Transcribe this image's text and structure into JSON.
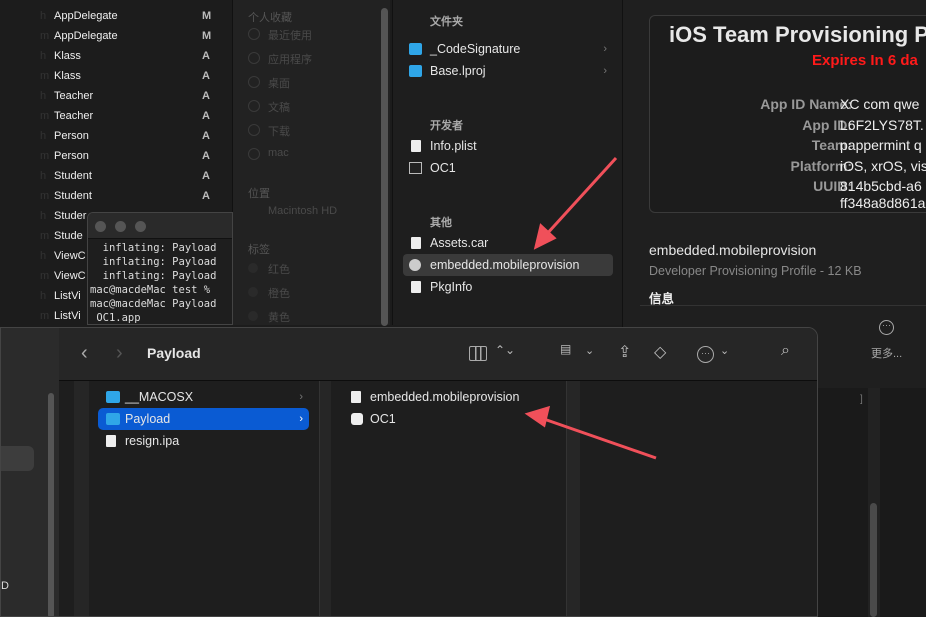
{
  "xcode_files": [
    {
      "k": "h",
      "name": "AppDelegate",
      "status": "M"
    },
    {
      "k": "m",
      "name": "AppDelegate",
      "status": "M"
    },
    {
      "k": "h",
      "name": "Klass",
      "status": "A"
    },
    {
      "k": "m",
      "name": "Klass",
      "status": "A"
    },
    {
      "k": "h",
      "name": "Teacher",
      "status": "A"
    },
    {
      "k": "m",
      "name": "Teacher",
      "status": "A"
    },
    {
      "k": "h",
      "name": "Person",
      "status": "A"
    },
    {
      "k": "m",
      "name": "Person",
      "status": "A"
    },
    {
      "k": "h",
      "name": "Student",
      "status": "A"
    },
    {
      "k": "m",
      "name": "Student",
      "status": "A"
    },
    {
      "k": "h",
      "name": "Studer",
      "status": ""
    },
    {
      "k": "m",
      "name": "Stude",
      "status": ""
    },
    {
      "k": "h",
      "name": "ViewC",
      "status": ""
    },
    {
      "k": "m",
      "name": "ViewC",
      "status": ""
    },
    {
      "k": "h",
      "name": "ListVi",
      "status": ""
    },
    {
      "k": "m",
      "name": "ListVi",
      "status": ""
    }
  ],
  "finder_sidebar": {
    "favorites_header": "个人收藏",
    "favorites": [
      "最近使用",
      "应用程序",
      "桌面",
      "文稿",
      "下载",
      "mac"
    ],
    "locations_header": "位置",
    "locations": [
      "Macintosh HD"
    ],
    "tags_header": "标签",
    "tags": [
      "红色",
      "橙色",
      "黄色"
    ]
  },
  "terminal": {
    "lines": [
      "  inflating: Payload",
      "  inflating: Payload",
      "  inflating: Payload",
      "mac@macdeMac test %",
      "mac@macdeMac Payload",
      " OC1.app"
    ]
  },
  "app_contents": {
    "folders_header": "文件夹",
    "folders": [
      "_CodeSignature",
      "Base.lproj"
    ],
    "dev_header": "开发者",
    "dev": [
      "Info.plist",
      "OC1"
    ],
    "other_header": "其他",
    "other": [
      "Assets.car",
      "embedded.mobileprovision",
      "PkgInfo"
    ]
  },
  "preview": {
    "title": "iOS Team Provisioning Pro",
    "expires": "Expires In 6 da",
    "fields": [
      {
        "label": "App ID Name:",
        "value": "XC com qwe"
      },
      {
        "label": "App ID:",
        "value": "L6F2LYS78T."
      },
      {
        "label": "Team:",
        "value": "pappermint q"
      },
      {
        "label": "Platform:",
        "value": "iOS, xrOS, vis"
      },
      {
        "label": "UUID:",
        "value": "814b5cbd-a6"
      }
    ],
    "uuid_cont": "ff348a8d861a",
    "filename": "embedded.mobileprovision",
    "subtitle": "Developer Provisioning Profile - 12 KB",
    "info": "信息",
    "more": "更多..."
  },
  "finder": {
    "title": "Payload",
    "sidebar_fragment": "D",
    "col1": [
      {
        "name": "__MACOSX",
        "type": "folder"
      },
      {
        "name": "Payload",
        "type": "folder",
        "selected": true
      },
      {
        "name": "resign.ipa",
        "type": "doc"
      }
    ],
    "col2": [
      {
        "name": "embedded.mobileprovision"
      },
      {
        "name": "OC1"
      }
    ]
  },
  "colors": {
    "accent": "#0a5bd3",
    "expires": "#ff1a1a",
    "arrow": "#f0505a"
  }
}
